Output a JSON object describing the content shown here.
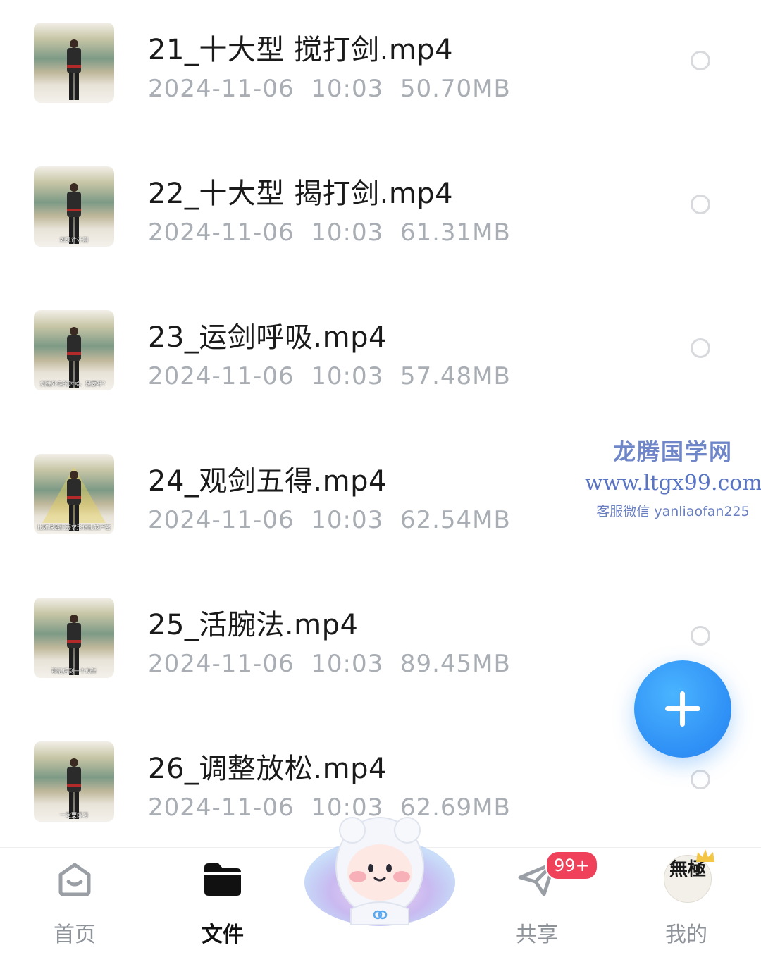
{
  "files": [
    {
      "name": "21_十大型 搅打剑.mp4",
      "date": "2024-11-06",
      "time": "10:03",
      "size": "50.70MB",
      "thumb_caption": "",
      "thumb_style": "standard"
    },
    {
      "name": "22_十大型 揭打剑.mp4",
      "date": "2024-11-06",
      "time": "10:03",
      "size": "61.31MB",
      "thumb_caption": "如果往外侧",
      "thumb_style": "standard"
    },
    {
      "name": "23_运剑呼吸.mp4",
      "date": "2024-11-06",
      "time": "10:03",
      "size": "57.48MB",
      "thumb_caption": "剑往外走的时候，是要呼？",
      "thumb_style": "standard"
    },
    {
      "name": "24_观剑五得.mp4",
      "date": "2024-11-06",
      "time": "10:03",
      "size": "62.54MB",
      "thumb_caption": "比如说我们要求形体比较严密",
      "thumb_style": "triangle"
    },
    {
      "name": "25_活腕法.mp4",
      "date": "2024-11-06",
      "time": "10:03",
      "size": "89.45MB",
      "thumb_caption": "那最后到一个动作",
      "thumb_style": "standard"
    },
    {
      "name": "26_调整放松.mp4",
      "date": "2024-11-06",
      "time": "10:03",
      "size": "62.69MB",
      "thumb_caption": "一定要练习",
      "thumb_style": "standard"
    }
  ],
  "watermark": {
    "title": "龙腾国学网",
    "url": "www.ltgx99.com",
    "contact": "客服微信 yanliaofan225"
  },
  "fab": {
    "icon": "plus-icon",
    "color": "#2e8ff5"
  },
  "nav": {
    "home": {
      "label": "首页",
      "icon": "home-icon"
    },
    "files": {
      "label": "文件",
      "icon": "folder-icon"
    },
    "share": {
      "label": "共享",
      "icon": "paper-plane-icon",
      "badge": "99+"
    },
    "mine": {
      "label": "我的",
      "icon": "avatar-icon",
      "avatar_text": "無極"
    }
  },
  "colors": {
    "accent": "#2e8ff5",
    "badge": "#f0415b",
    "meta_text": "#a9adb4",
    "watermark": "#5a74c4"
  }
}
